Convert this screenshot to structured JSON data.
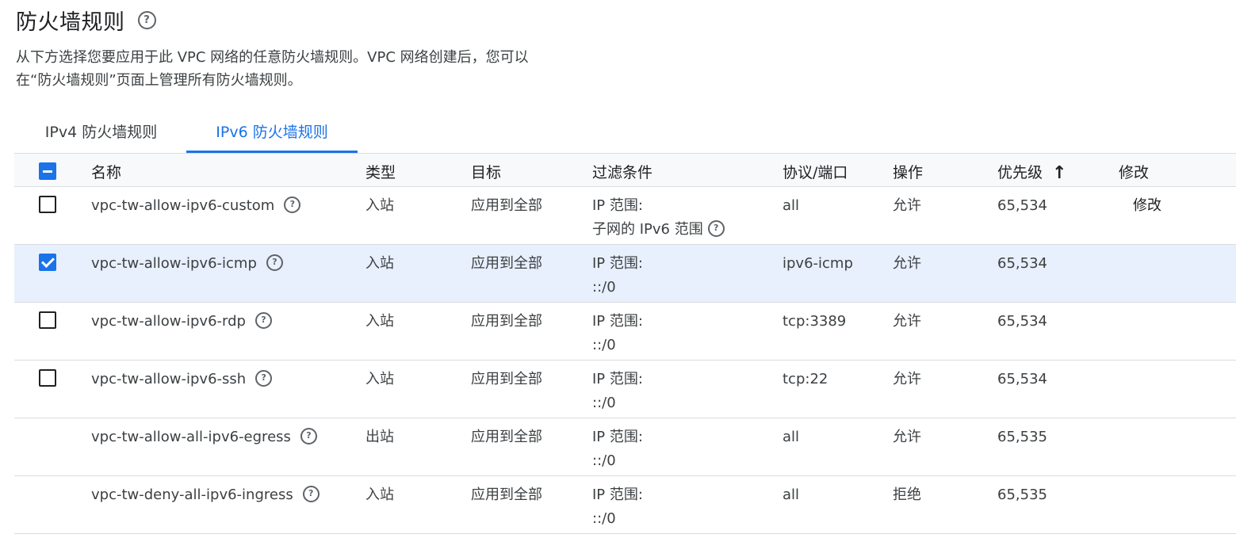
{
  "page": {
    "title": "防火墙规则",
    "description_line1": "从下方选择您要应用于此 VPC 网络的任意防火墙规则。VPC 网络创建后，您可以",
    "description_line2": "在“防火墙规则”页面上管理所有防火墙规则。"
  },
  "tabs": [
    {
      "label": "IPv4 防火墙规则",
      "active": false
    },
    {
      "label": "IPv6 防火墙规则",
      "active": true
    }
  ],
  "columns": {
    "name": "名称",
    "type": "类型",
    "target": "目标",
    "filter": "过滤条件",
    "protocol": "协议/端口",
    "action": "操作",
    "priority": "优先级",
    "edit": "修改"
  },
  "rows": [
    {
      "name": "vpc-tw-allow-ipv6-custom",
      "type": "入站",
      "target": "应用到全部",
      "filter_label": "IP 范围:",
      "filter_value": "子网的 IPv6 范围",
      "protocol": "all",
      "action": "允许",
      "priority": "65,534",
      "edit": "修改",
      "checked": false,
      "has_checkbox": true
    },
    {
      "name": "vpc-tw-allow-ipv6-icmp",
      "type": "入站",
      "target": "应用到全部",
      "filter_label": "IP 范围:",
      "filter_value": "::/0",
      "protocol": "ipv6-icmp",
      "action": "允许",
      "priority": "65,534",
      "edit": "",
      "checked": true,
      "has_checkbox": true
    },
    {
      "name": "vpc-tw-allow-ipv6-rdp",
      "type": "入站",
      "target": "应用到全部",
      "filter_label": "IP 范围:",
      "filter_value": "::/0",
      "protocol": "tcp:3389",
      "action": "允许",
      "priority": "65,534",
      "edit": "",
      "checked": false,
      "has_checkbox": true
    },
    {
      "name": "vpc-tw-allow-ipv6-ssh",
      "type": "入站",
      "target": "应用到全部",
      "filter_label": "IP 范围:",
      "filter_value": "::/0",
      "protocol": "tcp:22",
      "action": "允许",
      "priority": "65,534",
      "edit": "",
      "checked": false,
      "has_checkbox": true
    },
    {
      "name": "vpc-tw-allow-all-ipv6-egress",
      "type": "出站",
      "target": "应用到全部",
      "filter_label": "IP 范围:",
      "filter_value": "::/0",
      "protocol": "all",
      "action": "允许",
      "priority": "65,535",
      "edit": "",
      "checked": false,
      "has_checkbox": false
    },
    {
      "name": "vpc-tw-deny-all-ipv6-ingress",
      "type": "入站",
      "target": "应用到全部",
      "filter_label": "IP 范围:",
      "filter_value": "::/0",
      "protocol": "all",
      "action": "拒绝",
      "priority": "65,535",
      "edit": "",
      "checked": false,
      "has_checkbox": false
    }
  ],
  "icons": {
    "help": "help-circle-icon",
    "sort": "arrow-up-icon",
    "select_all": "indeterminate-checkbox-icon"
  },
  "colors": {
    "accent": "#1a73e8",
    "selected_row": "#e8f0fe",
    "header_bg": "#f8f9fa",
    "border": "#dadce0"
  }
}
